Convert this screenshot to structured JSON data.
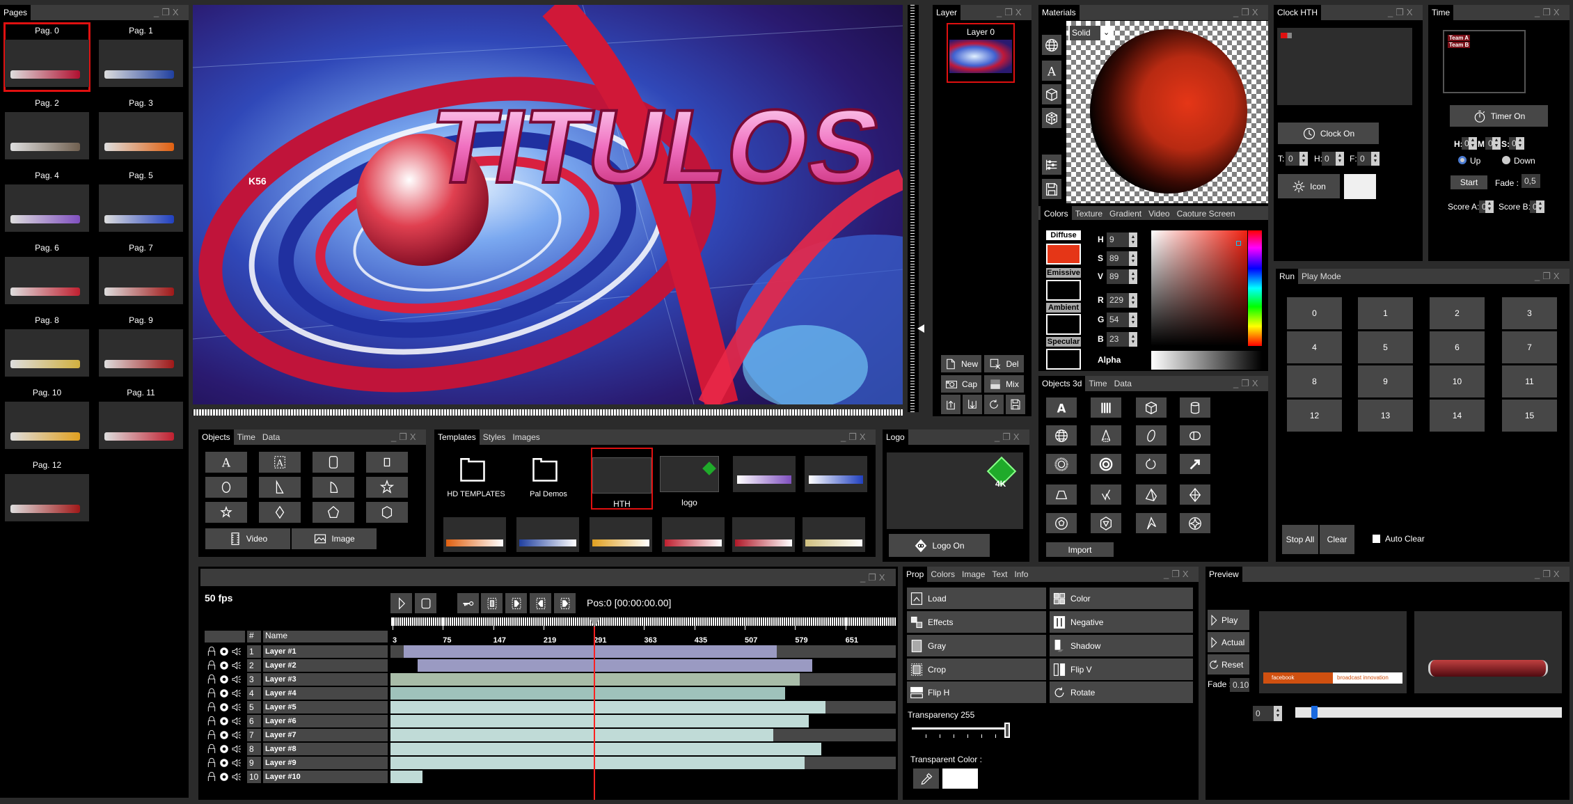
{
  "app": {
    "colors": {
      "workspace": "#2b2b2b",
      "panel_bg": "#000000",
      "titlebar": "#3c3c3c",
      "button": "#474747",
      "selection": "#e01010",
      "playhead": "#ff2020"
    }
  },
  "window_controls": {
    "minimize": "_",
    "restore": "❐",
    "close": "X"
  },
  "pages": {
    "title": "Pages",
    "items": [
      {
        "label": "Pag. 0",
        "selected": true,
        "accent": "#b01030"
      },
      {
        "label": "Pag. 1",
        "accent": "#2040a0"
      },
      {
        "label": "Pag. 2",
        "accent": "#706050"
      },
      {
        "label": "Pag. 3",
        "accent": "#e06010"
      },
      {
        "label": "Pag. 4",
        "accent": "#8050c0"
      },
      {
        "label": "Pag. 5",
        "accent": "#2040c0"
      },
      {
        "label": "Pag. 6",
        "accent": "#c02030"
      },
      {
        "label": "Pag. 7",
        "accent": "#a01818"
      },
      {
        "label": "Pag. 8",
        "accent": "#d0b040"
      },
      {
        "label": "Pag. 9",
        "accent": "#a01818"
      },
      {
        "label": "Pag. 10",
        "accent": "#e0a020"
      },
      {
        "label": "Pag. 11",
        "accent": "#c02030"
      },
      {
        "label": "Pag. 12",
        "accent": "#a01818"
      }
    ]
  },
  "preview": {
    "title_text": "TITULOS",
    "badge_text": "K56"
  },
  "layer": {
    "title": "Layer",
    "items": [
      {
        "label": "Layer 0",
        "selected": true
      }
    ],
    "buttons": {
      "new": "New",
      "del": "Del",
      "cap": "Cap",
      "mix": "Mix"
    },
    "icon_buttons": [
      "import-icon",
      "export-icon",
      "refresh-icon",
      "save-icon"
    ]
  },
  "materials": {
    "title": "Materials",
    "mode": "Solid",
    "tool_icons": [
      "globe-icon",
      "text-icon",
      "cube-icon",
      "dice-icon",
      "sliders-icon",
      "save-icon"
    ],
    "tabs": [
      "Colors",
      "Texture",
      "Gradient",
      "Video",
      "Caoture Screen"
    ],
    "slots": [
      {
        "label": "Diffuse",
        "color": "#e53617"
      },
      {
        "label": "Emissive",
        "color": "#000000"
      },
      {
        "label": "Ambient",
        "color": "#000000"
      },
      {
        "label": "Specular",
        "color": "#000000"
      }
    ],
    "fields": [
      {
        "label": "H",
        "value": "9"
      },
      {
        "label": "S",
        "value": "89"
      },
      {
        "label": "V",
        "value": "89"
      },
      {
        "label": "R",
        "value": "229"
      },
      {
        "label": "G",
        "value": "54"
      },
      {
        "label": "B",
        "value": "23"
      }
    ],
    "alpha_label": "Alpha",
    "sphere_color": "#e53617"
  },
  "objects3d": {
    "tabs": [
      "Objects 3d",
      "Time",
      "Data"
    ],
    "icons": [
      "text-3d-icon",
      "extrude-icon",
      "cube-icon",
      "cylinder-icon",
      "sphere-icon",
      "cone-icon",
      "ellipsoid-icon",
      "capsule-icon",
      "torus-icon",
      "ring-icon",
      "spiral-icon",
      "arrow-icon",
      "frustum-icon",
      "zigzag-icon",
      "pyramid-icon",
      "octahedron-icon",
      "dodecahedron-icon",
      "icosahedron-icon",
      "chevron-shape-icon",
      "star-sphere-icon"
    ],
    "import_label": "Import"
  },
  "clock": {
    "title": "Clock HTH",
    "clock_on": "Clock On",
    "icon_label": "Icon",
    "fields": [
      {
        "label": "T:",
        "value": "0"
      },
      {
        "label": "H:",
        "value": "0"
      },
      {
        "label": "F:",
        "value": "0"
      }
    ]
  },
  "time": {
    "title": "Time",
    "teams": [
      "Team A",
      "Team B"
    ],
    "timer_on": "Timer On",
    "hms": [
      {
        "label": "H:",
        "value": "0"
      },
      {
        "label": "M:",
        "value": "0"
      },
      {
        "label": "S:",
        "value": "0"
      }
    ],
    "direction": {
      "up": "Up",
      "down": "Down",
      "selected": "Up"
    },
    "start": "Start",
    "fade_label": "Fade :",
    "fade_value": "0,5",
    "scores": [
      {
        "label": "Score A:",
        "value": "0"
      },
      {
        "label": "Score B:",
        "value": "0"
      }
    ]
  },
  "run": {
    "tabs": [
      "Run",
      "Play Mode"
    ],
    "buttons": [
      "0",
      "1",
      "2",
      "3",
      "4",
      "5",
      "6",
      "7",
      "8",
      "9",
      "10",
      "11",
      "12",
      "13",
      "14",
      "15"
    ],
    "stop_all": "Stop All",
    "clear": "Clear",
    "auto_clear": "Auto Clear",
    "auto_clear_checked": false
  },
  "objects2d": {
    "tabs": [
      "Objects",
      "Time",
      "Data"
    ],
    "icons": [
      "text-icon",
      "text-box-icon",
      "rounded-rect-icon",
      "rect-icon",
      "circle-icon",
      "right-triangle-icon",
      "quarter-shape-icon",
      "star-icon",
      "star-small-icon",
      "diamond-icon",
      "pentagon-icon",
      "hexagon-icon"
    ],
    "video": "Video",
    "image": "Image"
  },
  "templates": {
    "tabs": [
      "Templates",
      "Styles",
      "Images"
    ],
    "folders": [
      "HD TEMPLATES",
      "Pal Demos"
    ],
    "items": [
      {
        "label": "HTH",
        "selected": true
      },
      {
        "label": "logo"
      }
    ],
    "thumbs_row1": [
      "#8050c0",
      "#2040c0"
    ],
    "thumbs_row2": [
      "#e06010",
      "#2040a0",
      "#e0a020",
      "#c02030",
      "#b01828",
      "#d0c080"
    ]
  },
  "logo": {
    "title": "Logo",
    "badge": "4K",
    "logo_on": "Logo On",
    "logo_color": "#1faa2a"
  },
  "timeline": {
    "fps": "50 fps",
    "position": "Pos:0 [00:00:00.00]",
    "playhead_frame": 291,
    "frame_range": [
      0,
      723
    ],
    "ruler_ticks": [
      "3",
      "75",
      "147",
      "219",
      "291",
      "363",
      "435",
      "507",
      "579",
      "651"
    ],
    "headers": {
      "num": "#",
      "name": "Name"
    },
    "toolbar_icons": [
      "play-icon",
      "stop-icon",
      "key-icon",
      "delete-key-icon",
      "next-key-icon",
      "prev-key-icon",
      "last-key-icon"
    ],
    "layers": [
      {
        "num": "1",
        "name": "Layer #1",
        "start": 19,
        "end": 553,
        "color": "#9a9ac2",
        "track_bg": true
      },
      {
        "num": "2",
        "name": "Layer #2",
        "start": 39,
        "end": 604,
        "color": "#9a9ac2",
        "track_bg": false
      },
      {
        "num": "3",
        "name": "Layer #3",
        "start": 0,
        "end": 586,
        "color": "#a8bca8",
        "track_bg": true
      },
      {
        "num": "4",
        "name": "Layer #4",
        "start": 0,
        "end": 565,
        "color": "#9fc2bb",
        "track_bg": false
      },
      {
        "num": "5",
        "name": "Layer #5",
        "start": 0,
        "end": 623,
        "color": "#c0dbd7",
        "track_bg": true
      },
      {
        "num": "6",
        "name": "Layer #6",
        "start": 0,
        "end": 599,
        "color": "#c0dbd7",
        "track_bg": false
      },
      {
        "num": "7",
        "name": "Layer #7",
        "start": 0,
        "end": 548,
        "color": "#c0dbd7",
        "track_bg": true
      },
      {
        "num": "8",
        "name": "Layer #8",
        "start": 0,
        "end": 617,
        "color": "#c0dbd7",
        "track_bg": false
      },
      {
        "num": "9",
        "name": "Layer #9",
        "start": 0,
        "end": 593,
        "color": "#c0dbd7",
        "track_bg": true
      },
      {
        "num": "10",
        "name": "Layer #10",
        "start": 0,
        "end": 46,
        "color": "#c0dbd7",
        "track_bg": false
      }
    ]
  },
  "prop": {
    "tabs": [
      "Prop",
      "Colors",
      "Image",
      "Text",
      "Info"
    ],
    "buttons": [
      [
        "Load",
        "Color"
      ],
      [
        "Effects",
        "Negative"
      ],
      [
        "Gray",
        "Shadow"
      ],
      [
        "Crop",
        "Flip V"
      ],
      [
        "Flip H",
        "Rotate"
      ]
    ],
    "transparency_label": "Transparency 255",
    "transparency_value": 255,
    "transparency_max": 255,
    "transparent_color_label": "Transparent Color :",
    "transparent_color": "#ffffff"
  },
  "preview_panel": {
    "title": "Preview",
    "buttons": [
      "Play",
      "Actual",
      "Reset"
    ],
    "fade_label": "Fade :",
    "fade_value": "0.10",
    "frame_value": "0",
    "slider_fraction": 0.06,
    "thumb_texts": [
      "facebook",
      "broadcast innovation"
    ]
  }
}
